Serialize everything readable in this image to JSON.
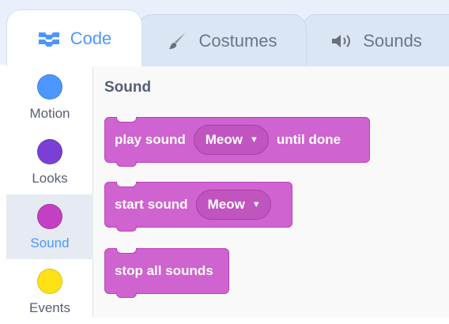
{
  "tabs": [
    {
      "label": "Code",
      "icon": "code-icon",
      "active": true
    },
    {
      "label": "Costumes",
      "icon": "brush-icon",
      "active": false
    },
    {
      "label": "Sounds",
      "icon": "speaker-icon",
      "active": false
    }
  ],
  "categories": [
    {
      "label": "Motion",
      "color": "#4c97ff"
    },
    {
      "label": "Looks",
      "color": "#9966ff"
    },
    {
      "label": "Sound",
      "color": "#cf63cf",
      "selected": true
    },
    {
      "label": "Events",
      "color": "#ffd500"
    }
  ],
  "palette": {
    "title": "Sound",
    "blocks": {
      "play_sound": {
        "before": "play sound",
        "dropdown": "Meow",
        "after": "until done"
      },
      "start_sound": {
        "before": "start sound",
        "dropdown": "Meow"
      },
      "stop_all": {
        "label": "stop all sounds"
      }
    }
  },
  "colors": {
    "accent": "#4c97ff",
    "sound_block": "#cf63cf",
    "text": "#575e75"
  }
}
